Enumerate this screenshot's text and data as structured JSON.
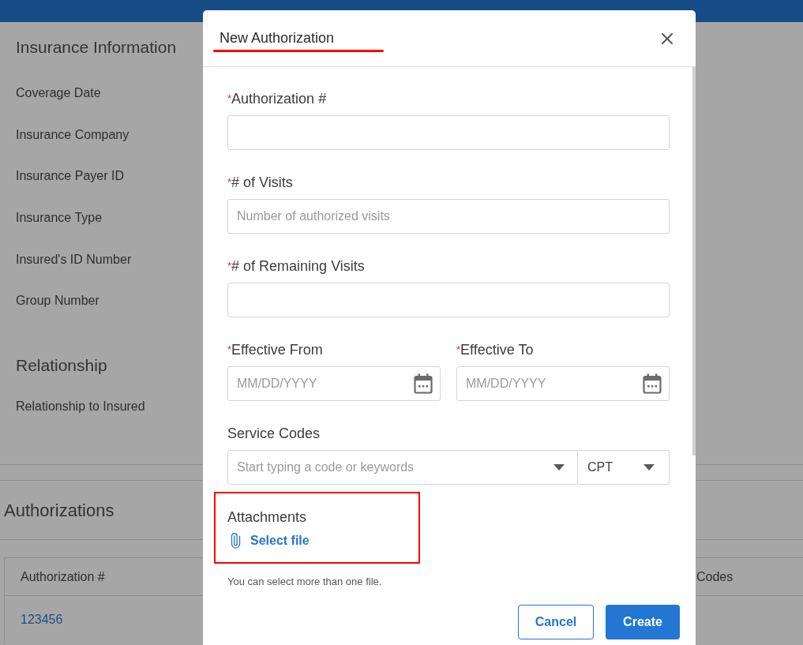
{
  "page": {
    "sections": [
      {
        "title": "Insurance Information",
        "fields": [
          "Coverage Date",
          "Insurance Company",
          "Insurance Payer ID",
          "Insurance Type",
          "Insured's ID Number",
          "Group Number"
        ]
      },
      {
        "title": "Relationship",
        "fields": [
          "Relationship to Insured"
        ]
      }
    ],
    "authorizations": {
      "title": "Authorizations",
      "table": {
        "columns": [
          "Authorization #",
          "Codes"
        ],
        "rows": [
          [
            "123456"
          ]
        ]
      }
    }
  },
  "dialog": {
    "title": "New Authorization",
    "title_highlighted": true,
    "fields": [
      {
        "kind": "text",
        "label": "Authorization #",
        "required_mark": "*"
      },
      {
        "kind": "text",
        "label": "# of Visits",
        "required_mark": "*",
        "placeholder": "Number of authorized visits"
      },
      {
        "kind": "text",
        "label": "# of Remaining Visits",
        "required_mark": "*"
      },
      {
        "kind": "date_pair",
        "items": [
          {
            "label": "Effective From",
            "required_mark": "*",
            "placeholder": "MM/DD/YYYY"
          },
          {
            "label": "Effective To",
            "required_mark": "*",
            "placeholder": "MM/DD/YYYY"
          }
        ]
      },
      {
        "kind": "code_search",
        "label": "Service Codes",
        "placeholder": "Start typing a code or keywords",
        "code_type": "CPT"
      }
    ],
    "attachments": {
      "label": "Attachments",
      "link": "Select file",
      "hint": "You can select more than one file.",
      "highlighted": true
    },
    "buttons": [
      {
        "label": "Cancel",
        "kind": "secondary"
      },
      {
        "label": "Create",
        "kind": "primary"
      }
    ]
  }
}
